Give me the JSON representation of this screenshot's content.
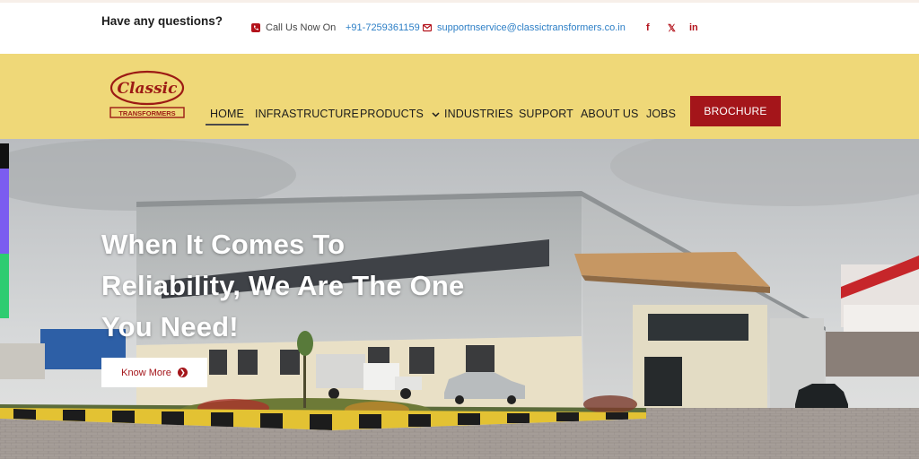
{
  "topbar": {
    "question": "Have any questions?",
    "call_label": "Call Us Now On",
    "phone": "+91-7259361159",
    "email": "supportnservice@classictransformers.co.in",
    "social": {
      "facebook": "f",
      "x": "𝕏",
      "linkedin": "in"
    }
  },
  "logo": {
    "script": "Classic",
    "word": "TRANSFORMERS"
  },
  "nav": {
    "items": [
      {
        "label": "HOME"
      },
      {
        "label": "INFRASTRUCTURE"
      },
      {
        "label": "PRODUCTS"
      },
      {
        "label": "INDUSTRIES"
      },
      {
        "label": "SUPPORT"
      },
      {
        "label": "ABOUT US"
      },
      {
        "label": "JOBS"
      }
    ],
    "brochure": "BROCHURE"
  },
  "hero": {
    "headline": "When It Comes To Reliability, We Are The One You Need!",
    "button": "Know More"
  },
  "colors": {
    "brand_red": "#a4151a",
    "nav_bg": "#efd878",
    "link_blue": "#2d7fc6",
    "side_purple": "#7b5cf0",
    "side_green": "#2ecc71"
  }
}
